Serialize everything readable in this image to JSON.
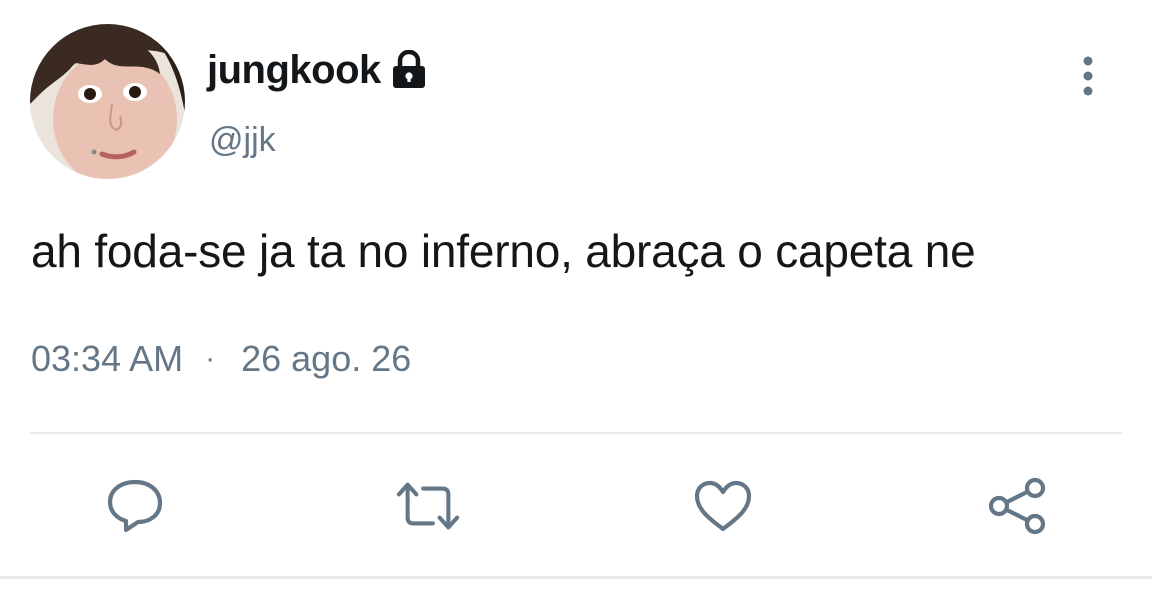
{
  "tweet": {
    "author": {
      "display_name": "jungkook",
      "handle": "@jjk",
      "protected_icon": "lock-icon",
      "avatar": "profile-photo"
    },
    "text": "ah foda-se ja ta no inferno, abraça o capeta ne",
    "time": "03:34 AM",
    "separator": "·",
    "date": "26 ago. 26"
  },
  "actions": {
    "more": "more-vertical-icon",
    "reply": "reply-icon",
    "retweet": "retweet-icon",
    "like": "heart-icon",
    "share": "share-icon"
  },
  "colors": {
    "text_primary": "#14171a",
    "text_secondary": "#657786",
    "divider": "#e6ecf0"
  }
}
